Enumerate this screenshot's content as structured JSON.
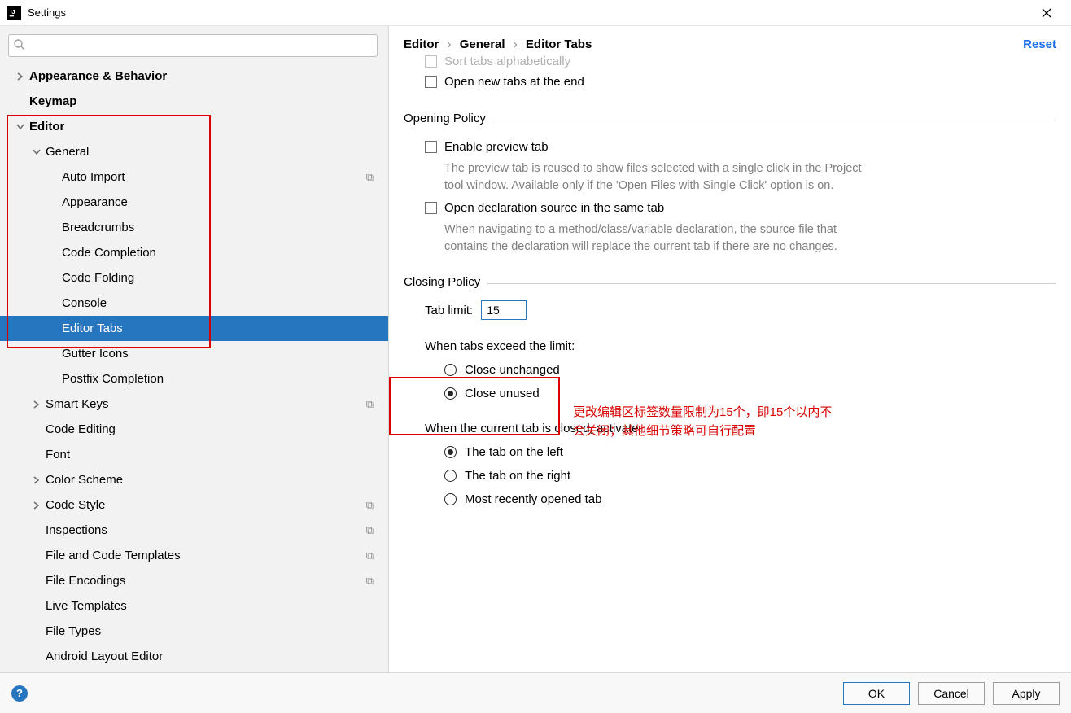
{
  "window": {
    "title": "Settings"
  },
  "breadcrumb": {
    "p0": "Editor",
    "p1": "General",
    "p2": "Editor Tabs",
    "reset": "Reset"
  },
  "tree": {
    "appearance": "Appearance & Behavior",
    "keymap": "Keymap",
    "editor": "Editor",
    "general": "General",
    "auto_import": "Auto Import",
    "gen_appearance": "Appearance",
    "breadcrumbs": "Breadcrumbs",
    "code_completion": "Code Completion",
    "code_folding": "Code Folding",
    "console": "Console",
    "editor_tabs": "Editor Tabs",
    "gutter_icons": "Gutter Icons",
    "postfix": "Postfix Completion",
    "smart_keys": "Smart Keys",
    "code_editing": "Code Editing",
    "font": "Font",
    "color_scheme": "Color Scheme",
    "code_style": "Code Style",
    "inspections": "Inspections",
    "file_templates": "File and Code Templates",
    "file_encodings": "File Encodings",
    "live_templates": "Live Templates",
    "file_types": "File Types",
    "android_layout": "Android Layout Editor"
  },
  "content": {
    "sort_tabs": "Sort tabs alphabetically",
    "open_end": "Open new tabs at the end",
    "opening_title": "Opening Policy",
    "enable_preview": "Enable preview tab",
    "preview_desc": "The preview tab is reused to show files selected with a single click in the Project tool window. Available only if the 'Open Files with Single Click' option is on.",
    "open_declaration": "Open declaration source in the same tab",
    "declaration_desc": "When navigating to a method/class/variable declaration, the source file that contains the declaration will replace the current tab if there are no changes.",
    "closing_title": "Closing Policy",
    "tab_limit_label": "Tab limit:",
    "tab_limit_value": "15",
    "exceed_label": "When tabs exceed the limit:",
    "close_unchanged": "Close unchanged",
    "close_unused": "Close unused",
    "activate_label": "When the current tab is closed, activate:",
    "tab_left": "The tab on the left",
    "tab_right": "The tab on the right",
    "tab_recent": "Most recently opened tab"
  },
  "annotation": {
    "text": "更改编辑区标签数量限制为15个，即15个以内不会关闭；其他细节策略可自行配置"
  },
  "buttons": {
    "ok": "OK",
    "cancel": "Cancel",
    "apply": "Apply"
  }
}
